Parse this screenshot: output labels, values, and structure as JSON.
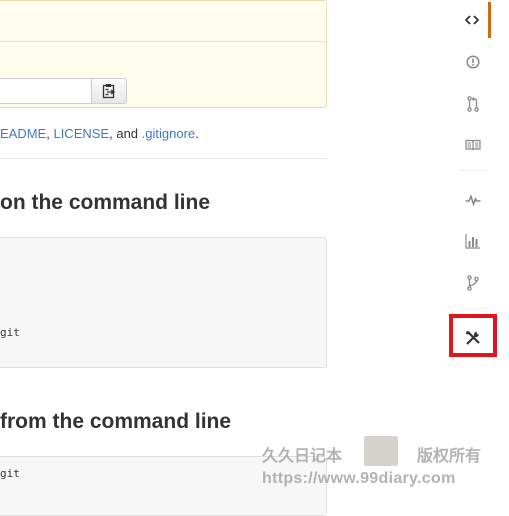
{
  "readme_line": {
    "readme": "EADME",
    "license": "LICENSE",
    "and": "and",
    "gitignore": ".gitignore"
  },
  "sections": {
    "create_heading": "on the command line",
    "push_heading": "from the command line"
  },
  "code": {
    "create_last_line": "git",
    "push_first_line": "git"
  },
  "repo_nav": {
    "items": [
      {
        "icon": "code-icon",
        "selected": true
      },
      {
        "icon": "issue-opened-icon",
        "selected": false
      },
      {
        "icon": "git-pull-request-icon",
        "selected": false
      },
      {
        "icon": "book-icon",
        "selected": false
      },
      {
        "icon": "pulse-icon",
        "selected": false
      },
      {
        "icon": "graph-icon",
        "selected": false
      },
      {
        "icon": "git-branch-icon",
        "selected": false
      },
      {
        "icon": "tools-icon",
        "selected": false
      }
    ]
  },
  "colors": {
    "link": "#4078c0",
    "selected_accent": "#d26911",
    "highlight": "#e0161d",
    "setup_background": "#fffdee"
  },
  "watermark": {
    "left_text": "久久日记本",
    "right_text": "版权所有",
    "url": "https://www.99diary.com"
  }
}
